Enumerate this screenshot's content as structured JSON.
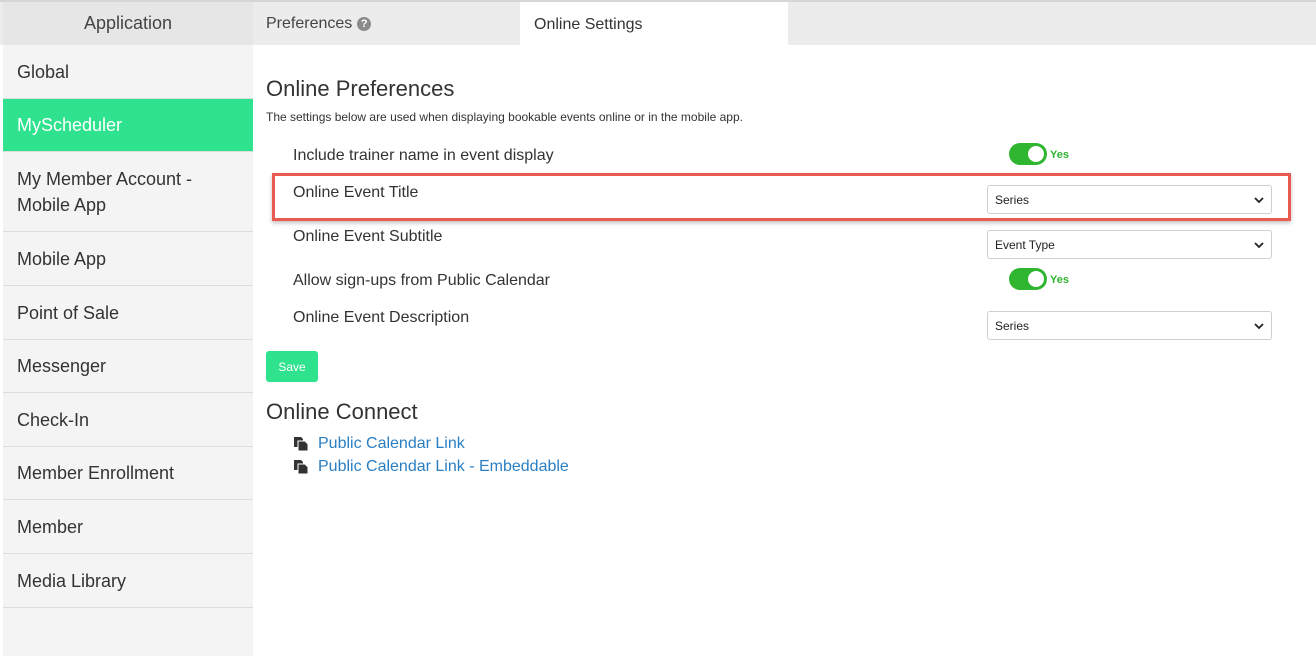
{
  "tabs": {
    "application": "Application",
    "preferences": "Preferences",
    "preferences_help_icon": "question-circle-icon",
    "online_settings": "Online Settings"
  },
  "sidebar": {
    "items": [
      {
        "label": "Global",
        "active": false
      },
      {
        "label": "MyScheduler",
        "active": true
      },
      {
        "label": "My Member Account - Mobile App",
        "active": false
      },
      {
        "label": "Mobile App",
        "active": false
      },
      {
        "label": "Point of Sale",
        "active": false
      },
      {
        "label": "Messenger",
        "active": false
      },
      {
        "label": "Check-In",
        "active": false
      },
      {
        "label": "Member Enrollment",
        "active": false
      },
      {
        "label": "Member",
        "active": false
      },
      {
        "label": "Media Library",
        "active": false
      }
    ]
  },
  "online_preferences": {
    "title": "Online Preferences",
    "description": "The settings below are used when displaying bookable events online or in the mobile app.",
    "rows": {
      "trainer_name": {
        "label": "Include trainer name in event display",
        "toggle_on": true,
        "toggle_text": "Yes"
      },
      "event_title": {
        "label": "Online Event Title",
        "value": "Series",
        "highlighted": true
      },
      "event_subtitle": {
        "label": "Online Event Subtitle",
        "value": "Event Type"
      },
      "public_signups": {
        "label": "Allow sign-ups from Public Calendar",
        "toggle_on": true,
        "toggle_text": "Yes"
      },
      "event_description": {
        "label": "Online Event Description",
        "value": "Series"
      }
    },
    "save_label": "Save"
  },
  "online_connect": {
    "title": "Online Connect",
    "links": [
      {
        "label": "Public Calendar Link",
        "icon": "copy-icon"
      },
      {
        "label": "Public Calendar Link - Embeddable",
        "icon": "copy-icon"
      }
    ]
  },
  "colors": {
    "accent_green": "#2fe28e",
    "toggle_green": "#2fb52f",
    "link_blue": "#2a7ec2",
    "highlight_red": "#e95b4e"
  }
}
